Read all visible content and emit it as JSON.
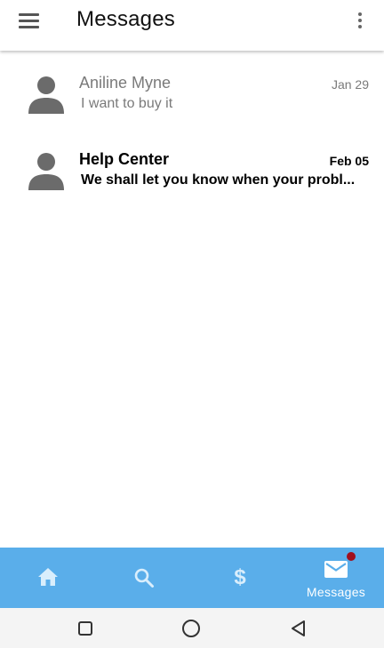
{
  "app_bar": {
    "title": "Messages",
    "menu_icon": "hamburger-menu-icon",
    "overflow_icon": "more-vert-icon"
  },
  "messages": [
    {
      "name": "Aniline Myne",
      "date": "Jan 29",
      "preview": "I want to buy it",
      "state": "read",
      "avatar_icon": "person-icon"
    },
    {
      "name": "Help Center",
      "date": "Feb 05",
      "preview": "We shall let you know when your probl...",
      "state": "unread",
      "avatar_icon": "person-icon"
    }
  ],
  "bottom_nav": {
    "tabs": [
      {
        "id": "home",
        "icon": "home-icon",
        "label": ""
      },
      {
        "id": "search",
        "icon": "search-icon",
        "label": ""
      },
      {
        "id": "payments",
        "icon": "dollar-icon",
        "glyph": "$",
        "label": ""
      },
      {
        "id": "messages",
        "icon": "mail-icon",
        "label": "Messages",
        "active": true,
        "has_notification": true
      }
    ]
  },
  "system_nav": {
    "buttons": [
      "recents-square-icon",
      "home-circle-icon",
      "back-triangle-icon"
    ]
  },
  "colors": {
    "nav_bar": "#5aaeea",
    "inactive_icon": "#d9eefc",
    "badge": "#a0101e",
    "read_text": "#7a7a7a",
    "avatar": "#6b6b6b"
  }
}
